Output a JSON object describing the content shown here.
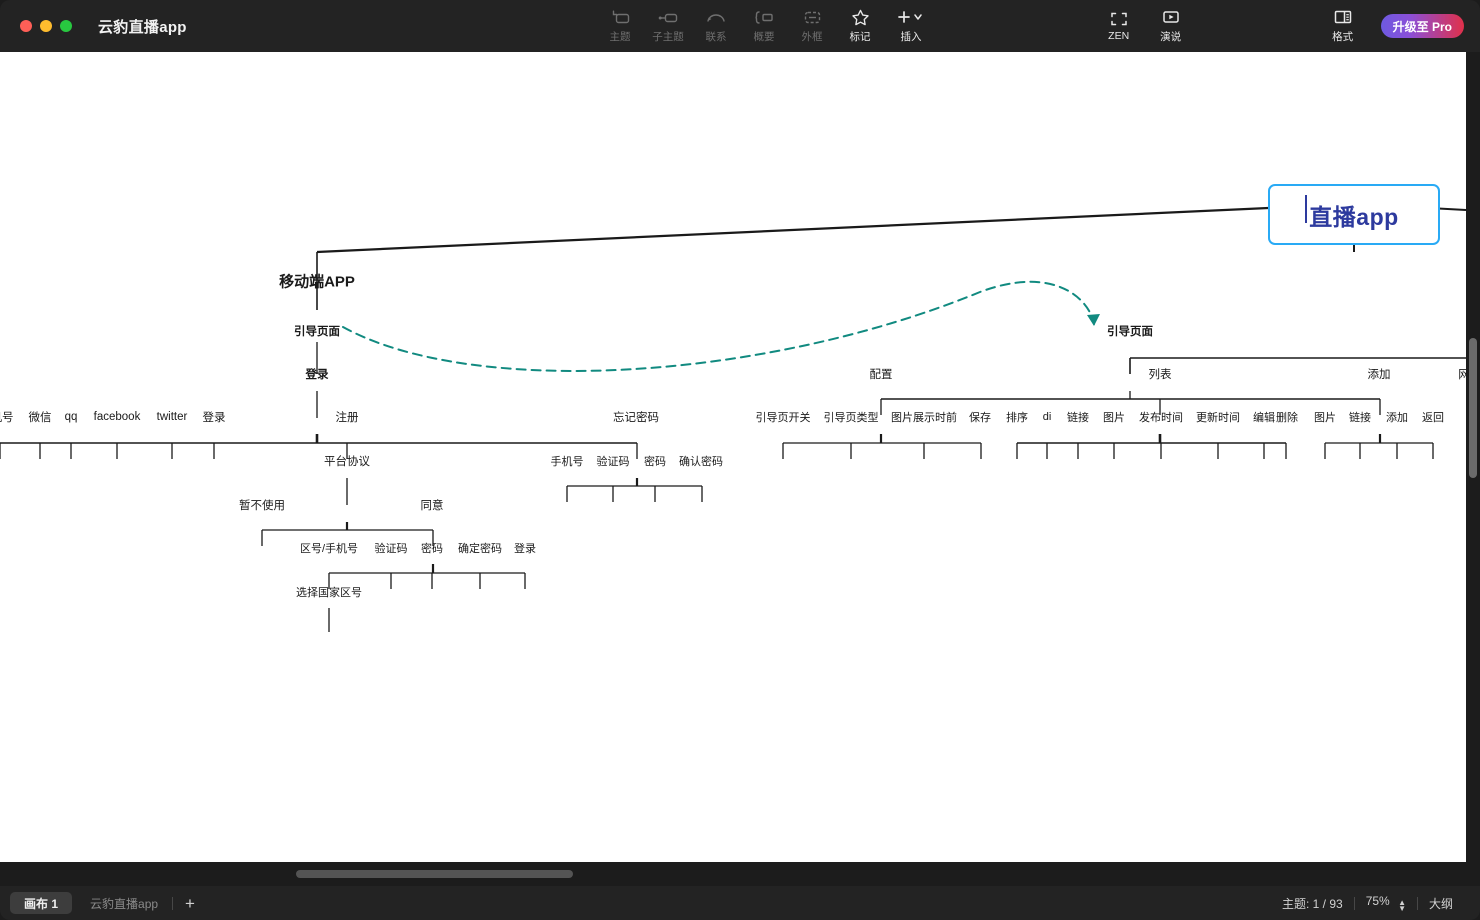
{
  "window": {
    "title": "云豹直播app",
    "traffic_lights": [
      "close",
      "minimize",
      "zoom"
    ]
  },
  "toolbar": {
    "center_items": [
      {
        "icon": "topic-icon",
        "label": "主题",
        "active": false
      },
      {
        "icon": "subtopic-icon",
        "label": "子主题",
        "active": false
      },
      {
        "icon": "relation-icon",
        "label": "联系",
        "active": false
      },
      {
        "icon": "summary-icon",
        "label": "概要",
        "active": false
      },
      {
        "icon": "boundary-icon",
        "label": "外框",
        "active": false
      },
      {
        "icon": "star-icon",
        "label": "标记",
        "active": true
      },
      {
        "icon": "plus-icon",
        "label": "插入",
        "active": true
      }
    ],
    "right_items": [
      {
        "icon": "zen-icon",
        "label": "ZEN"
      },
      {
        "icon": "play-icon",
        "label": "演说"
      },
      {
        "icon": "format-icon",
        "label": "格式"
      }
    ],
    "pro_button": "升级至 Pro",
    "accent_blue": "#29aaf5",
    "pro_gradient_from": "#6d5ae0",
    "pro_gradient_to": "#e0304a"
  },
  "mindmap": {
    "root": {
      "text": "直播app",
      "border_color": "#29aaf5",
      "text_color": "#2d3a9e"
    },
    "relation_line_color": "#118a80",
    "branch_color": "#1a1a1a",
    "nodes": {
      "n_mobile": "移动端APP",
      "n_guide_l": "引导页面",
      "n_login": "登录",
      "n_phone": "机号",
      "n_wechat": "微信",
      "n_qq": "qq",
      "n_fb": "facebook",
      "n_tw": "twitter",
      "n_login2": "登录",
      "n_reg": "注册",
      "n_forgot": "忘记密码",
      "n_f1": "手机号",
      "n_f2": "验证码",
      "n_f3": "密码",
      "n_f4": "确认密码",
      "n_pact": "平台协议",
      "n_nouse": "暂不使用",
      "n_agree": "同意",
      "n_a1": "区号/手机号",
      "n_a2": "验证码",
      "n_a3": "密码",
      "n_a4": "确定密码",
      "n_a5": "登录",
      "n_country": "选择国家区号",
      "n_guide_r": "引导页面",
      "n_config": "配置",
      "n_c1": "引导页开关",
      "n_c2": "引导页类型",
      "n_c3": "图片展示时前",
      "n_c4": "保存",
      "n_list": "列表",
      "n_l1": "排序",
      "n_l2": "di",
      "n_l3": "链接",
      "n_l4": "图片",
      "n_l5": "发布时间",
      "n_l6": "更新时间",
      "n_l7": "编辑",
      "n_l8": "删除",
      "n_add": "添加",
      "n_d1": "图片",
      "n_d2": "链接",
      "n_d3": "添加",
      "n_d4": "返回",
      "n_web": "网"
    }
  },
  "statusbar": {
    "canvas_tab": "画布 1",
    "sheet_name": "云豹直播app",
    "add_tab": "+",
    "topic_count": "主题: 1 / 93",
    "zoom_level": "75%",
    "outline_label": "大纲"
  }
}
